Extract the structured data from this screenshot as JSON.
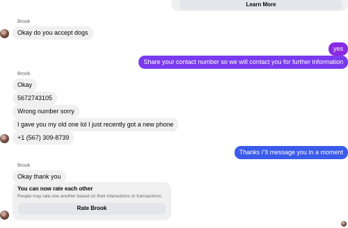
{
  "top_card": {
    "learn_more_label": "Learn More"
  },
  "thread": {
    "sender_name": "Brook",
    "group1": {
      "message": "Okay do you accept dogs"
    },
    "outgoing1": [
      {
        "text": "yes"
      },
      {
        "text": "Share your contact number so we will contact you for further information"
      }
    ],
    "group2": [
      {
        "text": "Okay"
      },
      {
        "text": "5672743105"
      },
      {
        "text": "Wrong number sorry"
      },
      {
        "text": "I gave you my old one lol I just recently got a new phone"
      },
      {
        "text": "+1 (567) 309-8739"
      }
    ],
    "outgoing2": {
      "text": "Thanks i\"ll message you in a moment"
    },
    "group3": {
      "message": "Okay thank you"
    }
  },
  "rating_card": {
    "title": "You can now rate each other",
    "subtitle": "People may rate one another based on their interactions or transactions.",
    "button_label": "Rate Brook"
  },
  "colors": {
    "outgoing_purple": "#8a2be2",
    "outgoing_blue": "#3b5bea",
    "incoming_bg": "#f0f0f0"
  }
}
